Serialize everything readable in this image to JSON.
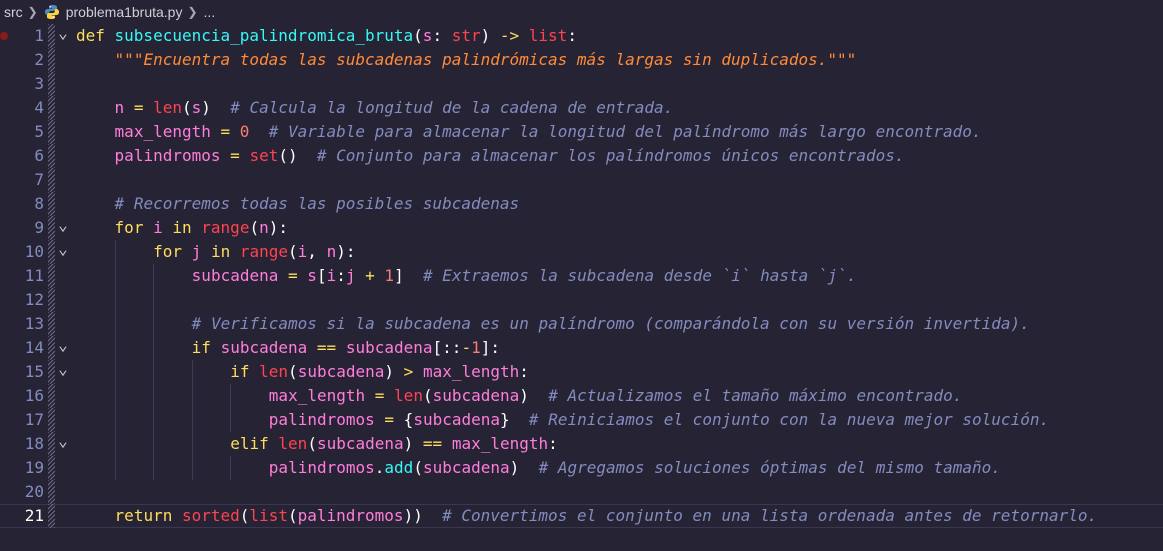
{
  "breadcrumb": {
    "folder": "src",
    "file": "problema1bruta.py",
    "ellipsis": "..."
  },
  "editor": {
    "active_line": 21,
    "lines": [
      {
        "n": "1",
        "fold": true,
        "bp": true,
        "indent": 0,
        "tokens": [
          [
            "kw",
            "def "
          ],
          [
            "fn",
            "subsecuencia_palindromica_bruta"
          ],
          [
            "tx",
            "("
          ],
          [
            "pr",
            "s"
          ],
          [
            "tx",
            ": "
          ],
          [
            "ty",
            "str"
          ],
          [
            "tx",
            ") "
          ],
          [
            "op",
            "->"
          ],
          [
            "tx",
            " "
          ],
          [
            "ty",
            "list"
          ],
          [
            "tx",
            ":"
          ]
        ]
      },
      {
        "n": "2",
        "indent": 1,
        "tokens": [
          [
            "st",
            "\"\"\"Encuentra todas las subcadenas palindrómicas más largas sin duplicados.\"\"\""
          ]
        ]
      },
      {
        "n": "3",
        "indent": 1,
        "tokens": []
      },
      {
        "n": "4",
        "indent": 1,
        "tokens": [
          [
            "va",
            "n"
          ],
          [
            "tx",
            " "
          ],
          [
            "op",
            "="
          ],
          [
            "tx",
            " "
          ],
          [
            "bi",
            "len"
          ],
          [
            "tx",
            "("
          ],
          [
            "va",
            "s"
          ],
          [
            "tx",
            ")  "
          ],
          [
            "cm",
            "# Calcula la longitud de la cadena de entrada."
          ]
        ]
      },
      {
        "n": "5",
        "indent": 1,
        "tokens": [
          [
            "va",
            "max_length"
          ],
          [
            "tx",
            " "
          ],
          [
            "op",
            "="
          ],
          [
            "tx",
            " "
          ],
          [
            "nm",
            "0"
          ],
          [
            "tx",
            "  "
          ],
          [
            "cm",
            "# Variable para almacenar la longitud del palíndromo más largo encontrado."
          ]
        ]
      },
      {
        "n": "6",
        "indent": 1,
        "tokens": [
          [
            "va",
            "palindromos"
          ],
          [
            "tx",
            " "
          ],
          [
            "op",
            "="
          ],
          [
            "tx",
            " "
          ],
          [
            "bi",
            "set"
          ],
          [
            "tx",
            "()  "
          ],
          [
            "cm",
            "# Conjunto para almacenar los palíndromos únicos encontrados."
          ]
        ]
      },
      {
        "n": "7",
        "indent": 1,
        "tokens": []
      },
      {
        "n": "8",
        "indent": 1,
        "tokens": [
          [
            "cm",
            "# Recorremos todas las posibles subcadenas"
          ]
        ]
      },
      {
        "n": "9",
        "fold": true,
        "indent": 1,
        "tokens": [
          [
            "kw",
            "for"
          ],
          [
            "tx",
            " "
          ],
          [
            "va",
            "i"
          ],
          [
            "tx",
            " "
          ],
          [
            "kw",
            "in"
          ],
          [
            "tx",
            " "
          ],
          [
            "bi",
            "range"
          ],
          [
            "tx",
            "("
          ],
          [
            "va",
            "n"
          ],
          [
            "tx",
            "):"
          ]
        ]
      },
      {
        "n": "10",
        "fold": true,
        "indent": 2,
        "tokens": [
          [
            "kw",
            "for"
          ],
          [
            "tx",
            " "
          ],
          [
            "va",
            "j"
          ],
          [
            "tx",
            " "
          ],
          [
            "kw",
            "in"
          ],
          [
            "tx",
            " "
          ],
          [
            "bi",
            "range"
          ],
          [
            "tx",
            "("
          ],
          [
            "va",
            "i"
          ],
          [
            "tx",
            ", "
          ],
          [
            "va",
            "n"
          ],
          [
            "tx",
            "):"
          ]
        ]
      },
      {
        "n": "11",
        "indent": 3,
        "tokens": [
          [
            "va",
            "subcadena"
          ],
          [
            "tx",
            " "
          ],
          [
            "op",
            "="
          ],
          [
            "tx",
            " "
          ],
          [
            "va",
            "s"
          ],
          [
            "tx",
            "["
          ],
          [
            "va",
            "i"
          ],
          [
            "tx",
            ":"
          ],
          [
            "va",
            "j"
          ],
          [
            "tx",
            " "
          ],
          [
            "op",
            "+"
          ],
          [
            "tx",
            " "
          ],
          [
            "nm",
            "1"
          ],
          [
            "tx",
            "]  "
          ],
          [
            "cm",
            "# Extraemos la subcadena desde `i` hasta `j`."
          ]
        ]
      },
      {
        "n": "12",
        "indent": 3,
        "tokens": []
      },
      {
        "n": "13",
        "indent": 3,
        "tokens": [
          [
            "cm",
            "# Verificamos si la subcadena es un palíndromo (comparándola con su versión invertida)."
          ]
        ]
      },
      {
        "n": "14",
        "fold": true,
        "indent": 3,
        "tokens": [
          [
            "kw",
            "if"
          ],
          [
            "tx",
            " "
          ],
          [
            "va",
            "subcadena"
          ],
          [
            "tx",
            " "
          ],
          [
            "op",
            "=="
          ],
          [
            "tx",
            " "
          ],
          [
            "va",
            "subcadena"
          ],
          [
            "tx",
            "[::"
          ],
          [
            "op",
            "-"
          ],
          [
            "nm",
            "1"
          ],
          [
            "tx",
            "]:"
          ]
        ]
      },
      {
        "n": "15",
        "fold": true,
        "indent": 4,
        "tokens": [
          [
            "kw",
            "if"
          ],
          [
            "tx",
            " "
          ],
          [
            "bi",
            "len"
          ],
          [
            "tx",
            "("
          ],
          [
            "va",
            "subcadena"
          ],
          [
            "tx",
            ") "
          ],
          [
            "op",
            ">"
          ],
          [
            "tx",
            " "
          ],
          [
            "va",
            "max_length"
          ],
          [
            "tx",
            ":"
          ]
        ]
      },
      {
        "n": "16",
        "indent": 5,
        "tokens": [
          [
            "va",
            "max_length"
          ],
          [
            "tx",
            " "
          ],
          [
            "op",
            "="
          ],
          [
            "tx",
            " "
          ],
          [
            "bi",
            "len"
          ],
          [
            "tx",
            "("
          ],
          [
            "va",
            "subcadena"
          ],
          [
            "tx",
            ")  "
          ],
          [
            "cm",
            "# Actualizamos el tamaño máximo encontrado."
          ]
        ]
      },
      {
        "n": "17",
        "indent": 5,
        "tokens": [
          [
            "va",
            "palindromos"
          ],
          [
            "tx",
            " "
          ],
          [
            "op",
            "="
          ],
          [
            "tx",
            " {"
          ],
          [
            "va",
            "subcadena"
          ],
          [
            "tx",
            "}  "
          ],
          [
            "cm",
            "# Reiniciamos el conjunto con la nueva mejor solución."
          ]
        ]
      },
      {
        "n": "18",
        "fold": true,
        "indent": 4,
        "tokens": [
          [
            "kw",
            "elif"
          ],
          [
            "tx",
            " "
          ],
          [
            "bi",
            "len"
          ],
          [
            "tx",
            "("
          ],
          [
            "va",
            "subcadena"
          ],
          [
            "tx",
            ") "
          ],
          [
            "op",
            "=="
          ],
          [
            "tx",
            " "
          ],
          [
            "va",
            "max_length"
          ],
          [
            "tx",
            ":"
          ]
        ]
      },
      {
        "n": "19",
        "indent": 5,
        "tokens": [
          [
            "va",
            "palindromos"
          ],
          [
            "tx",
            "."
          ],
          [
            "fn",
            "add"
          ],
          [
            "tx",
            "("
          ],
          [
            "va",
            "subcadena"
          ],
          [
            "tx",
            ")  "
          ],
          [
            "cm",
            "# Agregamos soluciones óptimas del mismo tamaño."
          ]
        ]
      },
      {
        "n": "20",
        "indent": 1,
        "tokens": []
      },
      {
        "n": "21",
        "indent": 1,
        "tokens": [
          [
            "kw",
            "return"
          ],
          [
            "tx",
            " "
          ],
          [
            "bi",
            "sorted"
          ],
          [
            "tx",
            "("
          ],
          [
            "bi",
            "list"
          ],
          [
            "tx",
            "("
          ],
          [
            "va",
            "palindromos"
          ],
          [
            "tx",
            "))  "
          ],
          [
            "cm",
            "# Convertimos el conjunto en una lista ordenada antes de retornarlo."
          ]
        ]
      }
    ]
  }
}
